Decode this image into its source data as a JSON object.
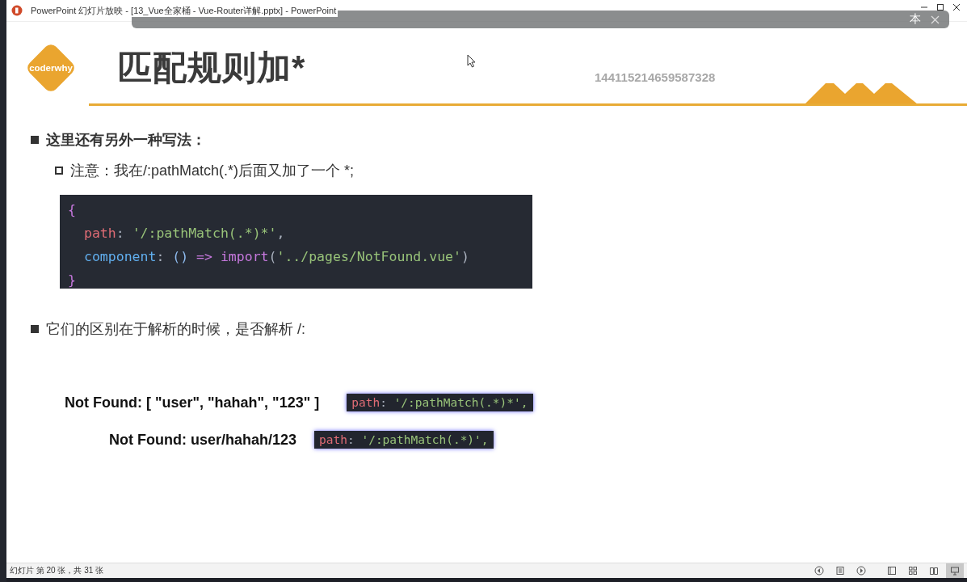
{
  "window": {
    "title": "PowerPoint 幻灯片放映 - [13_Vue全家桶 - Vue-Router详解.pptx] - PowerPoint"
  },
  "overlay_toolbar": {
    "label": "本"
  },
  "slide": {
    "logo": "coderwhy",
    "title": "匹配规则加*",
    "number": "144115214659587328",
    "content": [
      {
        "kind": "bullet",
        "text": "这里还有另外一种写法："
      },
      {
        "kind": "sub-bullet",
        "text": "注意：我在/:pathMatch(.*)后面又加了一个 *;"
      },
      {
        "kind": "code",
        "lines": [
          [
            {
              "kind": "brace",
              "text": "{"
            }
          ],
          [
            {
              "kind": "key",
              "text": "path"
            },
            {
              "kind": "punct",
              "text": ": "
            },
            {
              "kind": "string",
              "text": "'/:pathMatch(.*)*'"
            },
            {
              "kind": "punct",
              "text": ","
            }
          ],
          [
            {
              "kind": "prop",
              "text": "component"
            },
            {
              "kind": "punct",
              "text": ": "
            },
            {
              "kind": "paren",
              "text": "() "
            },
            {
              "kind": "keyword",
              "text": "=> "
            },
            {
              "kind": "keyword",
              "text": "import"
            },
            {
              "kind": "punct",
              "text": "("
            },
            {
              "kind": "string",
              "text": "'../pages/NotFound.vue'"
            },
            {
              "kind": "punct",
              "text": ")"
            }
          ],
          [
            {
              "kind": "brace",
              "text": "}"
            }
          ]
        ]
      },
      {
        "kind": "plain-bullet",
        "text": "它们的区别在于解析的时候，是否解析 /:"
      },
      {
        "kind": "examples",
        "rows": [
          {
            "label": "Not Found: [ \"user\", \"hahah\", \"123\" ]",
            "code": [
              {
                "kind": "key",
                "text": "path"
              },
              {
                "kind": "punct",
                "text": ": "
              },
              {
                "kind": "string",
                "text": "'/:pathMatch(.*)*',"
              }
            ]
          },
          {
            "label": "Not Found: user/hahah/123",
            "code": [
              {
                "kind": "key",
                "text": "path"
              },
              {
                "kind": "punct",
                "text": ": "
              },
              {
                "kind": "string",
                "text": "'/:pathMatch(.*)',"
              }
            ]
          }
        ]
      }
    ]
  },
  "status_bar": {
    "text": "幻灯片 第 20 张，共 31 张",
    "buttons": [
      {
        "kind": "prev",
        "selected": false
      },
      {
        "kind": "list",
        "selected": false
      },
      {
        "kind": "next",
        "selected": false
      },
      {
        "kind": "normal",
        "selected": false
      },
      {
        "kind": "sorter",
        "selected": false
      },
      {
        "kind": "reading",
        "selected": false
      },
      {
        "kind": "show",
        "selected": true
      }
    ]
  }
}
